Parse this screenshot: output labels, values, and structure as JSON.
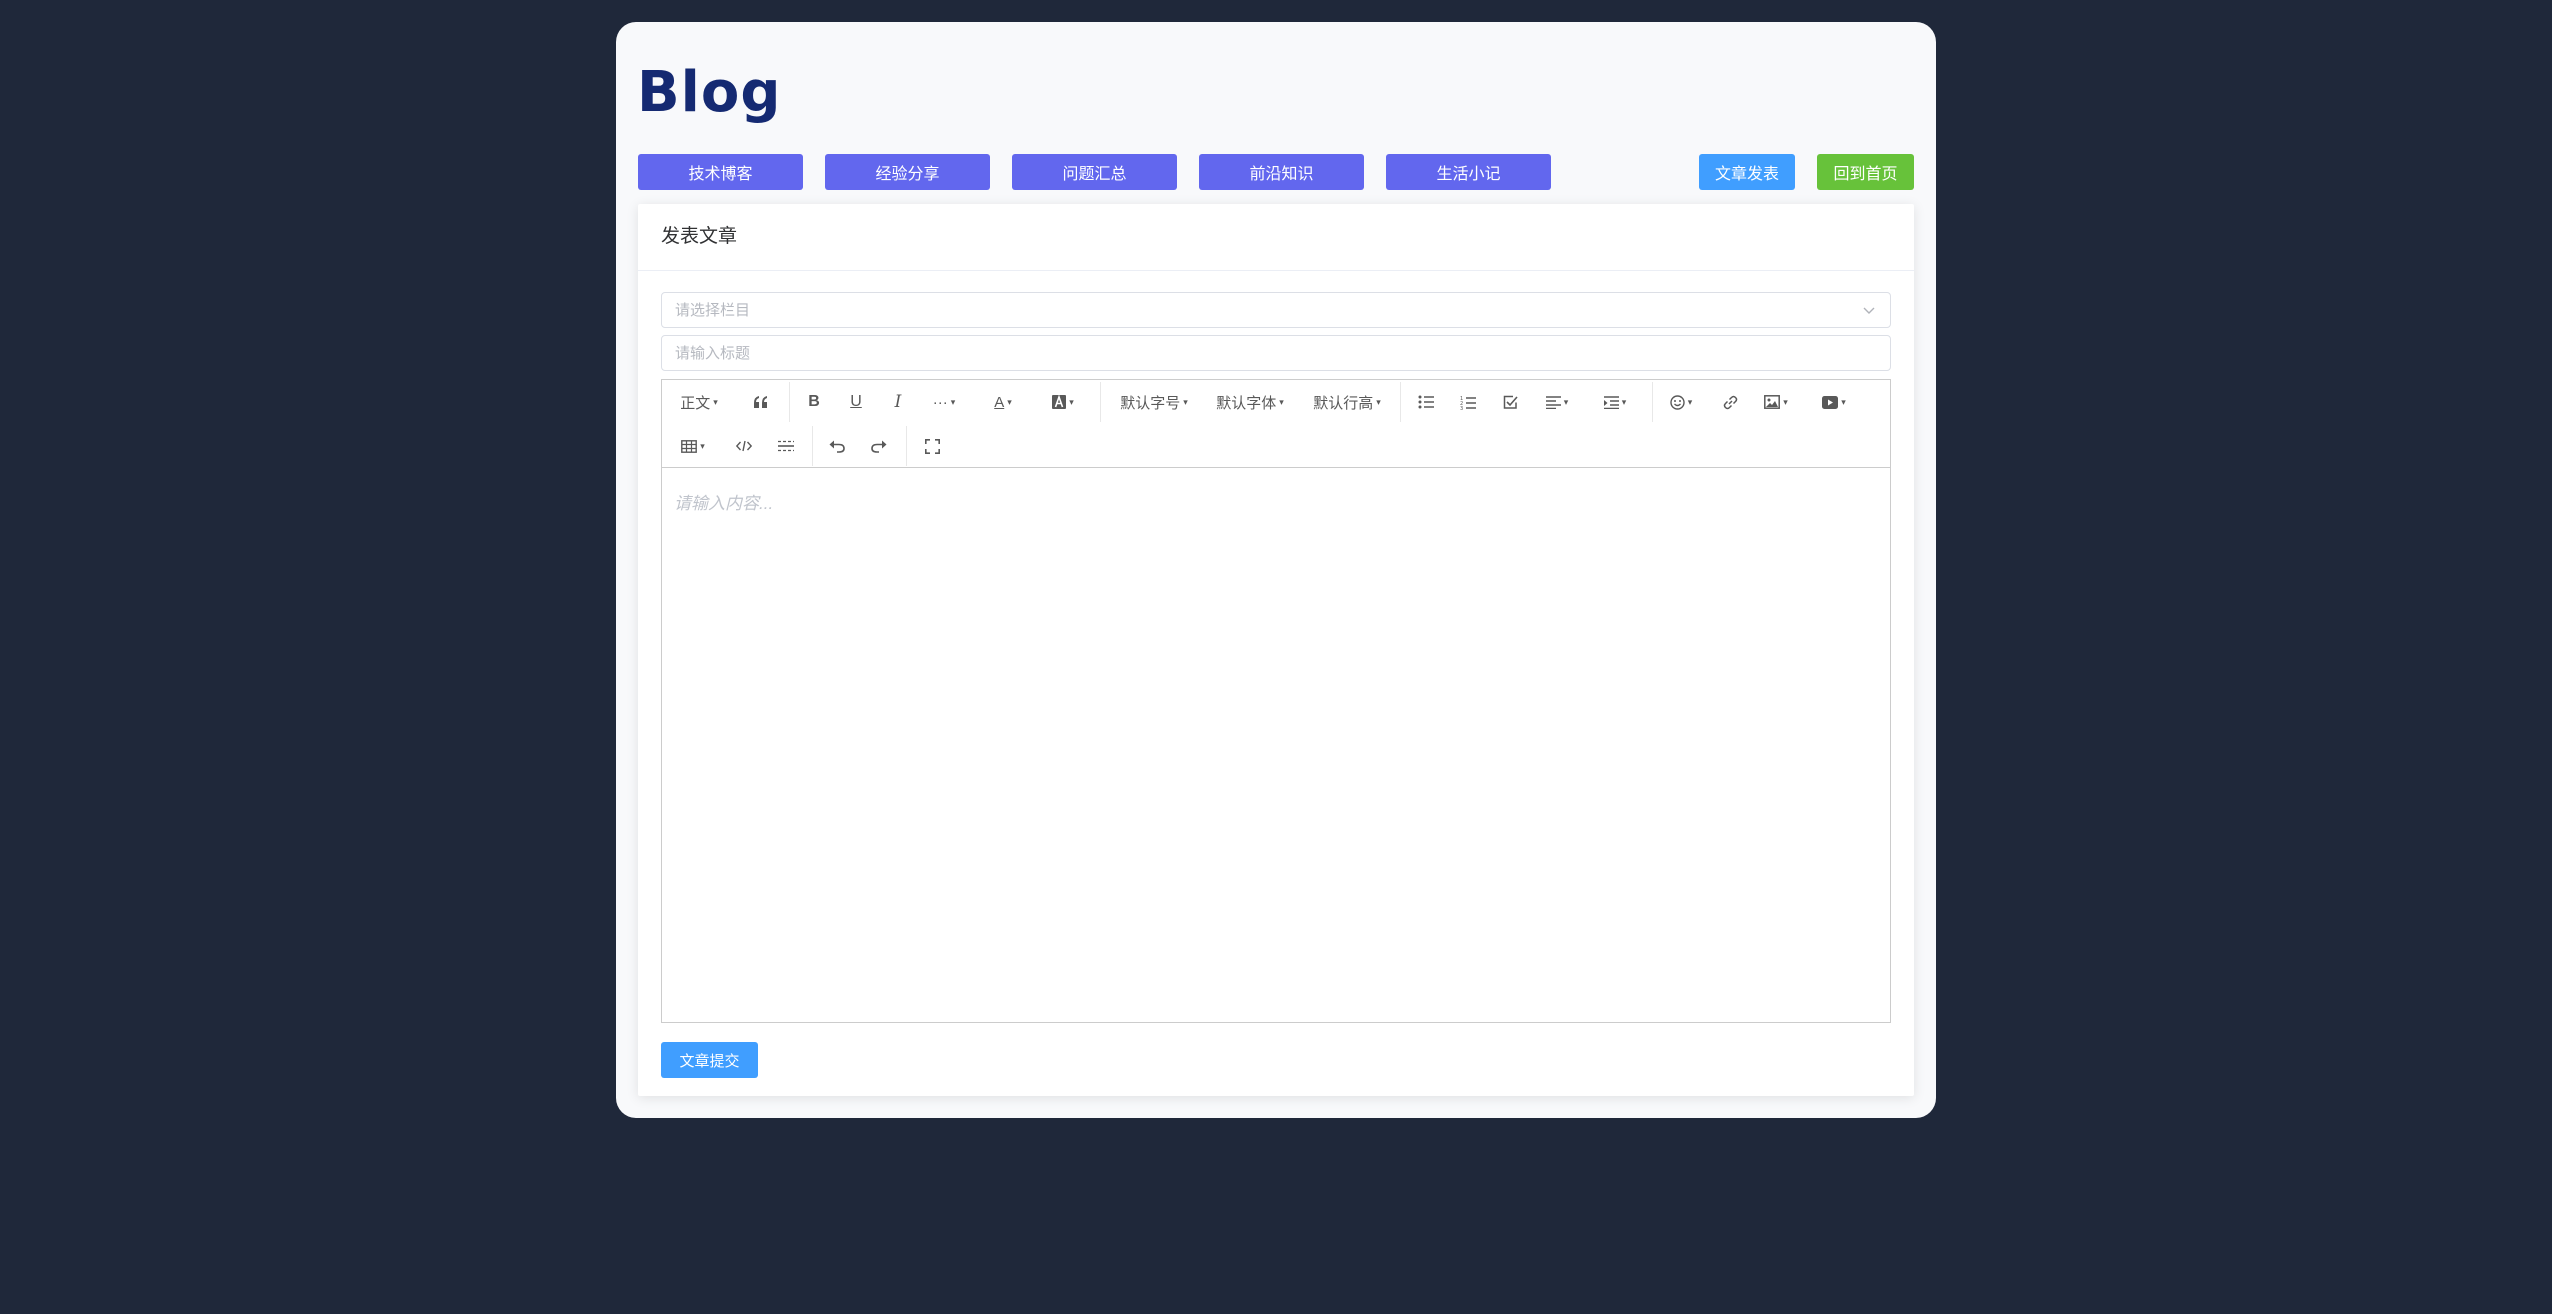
{
  "logo": "Blog",
  "nav": {
    "categories": [
      "技术博客",
      "经验分享",
      "问题汇总",
      "前沿知识",
      "生活小记"
    ],
    "publish_label": "文章发表",
    "home_label": "回到首页"
  },
  "card": {
    "title": "发表文章",
    "column_select_placeholder": "请选择栏目",
    "title_input_placeholder": "请输入标题",
    "submit_label": "文章提交"
  },
  "editor": {
    "toolbar": {
      "heading": "正文",
      "font_size": "默认字号",
      "font_family": "默认字体",
      "line_height": "默认行高"
    },
    "content_placeholder": "请输入内容..."
  },
  "colors": {
    "background": "#1f283a",
    "logo": "#152a72",
    "category_button": "#6267ee",
    "primary_button": "#409eff",
    "success_button": "#67c23a"
  }
}
